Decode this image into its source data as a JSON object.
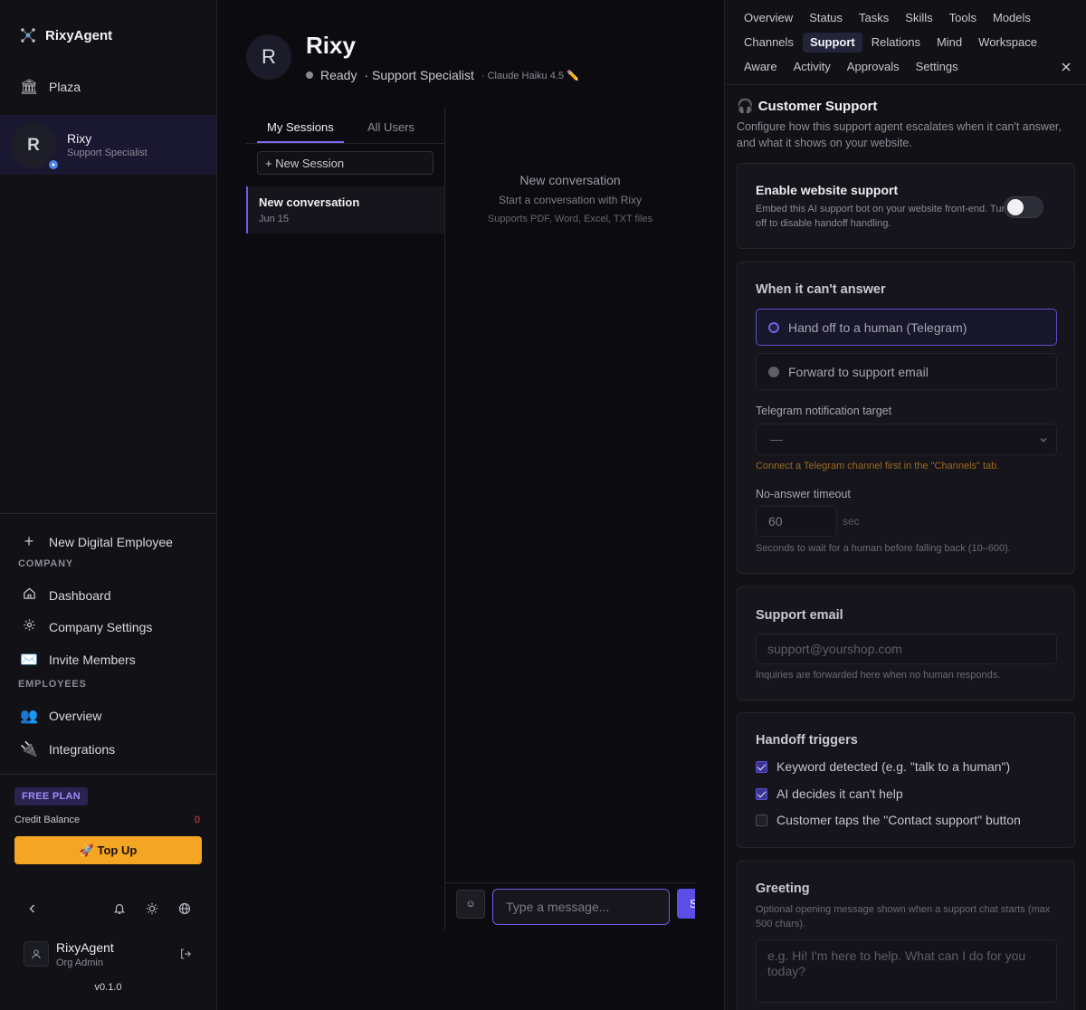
{
  "sidebar": {
    "brand": "RixyAgent",
    "plaza": "Plaza",
    "agent": {
      "initial": "R",
      "name": "Rixy",
      "role": "Support Specialist"
    },
    "new_employee": "New Digital Employee",
    "company_section": "COMPANY",
    "company_items": [
      "Dashboard",
      "Company Settings",
      "Invite Members"
    ],
    "employees_section": "EMPLOYEES",
    "employee_items": [
      "Overview",
      "Integrations"
    ],
    "plan": "FREE PLAN",
    "credit_label": "Credit Balance",
    "credit_value": "0",
    "topup": "🚀 Top Up",
    "user": {
      "name": "RixyAgent",
      "role": "Org Admin"
    },
    "version": "v0.1.0"
  },
  "main": {
    "avatar_initial": "R",
    "name": "Rixy",
    "status": "Ready",
    "role": "· Support Specialist",
    "model": "· Claude Haiku 4.5 ✏️",
    "tabs": [
      "My Sessions",
      "All Users"
    ],
    "new_session": "+ New Session",
    "session": {
      "title": "New conversation",
      "date": "Jun 15"
    },
    "empty_title": "New conversation",
    "empty_sub": "Start a conversation with Rixy",
    "empty_hint": "Supports PDF, Word, Excel, TXT files",
    "emoji": "☺",
    "input_placeholder": "Type a message...",
    "send": "Send"
  },
  "panel": {
    "tabs_row1": [
      "Overview",
      "Status",
      "Tasks",
      "Skills",
      "Tools",
      "Models"
    ],
    "tabs_row2": [
      "Channels",
      "Support",
      "Relations",
      "Mind",
      "Workspace"
    ],
    "tabs_row3": [
      "Aware",
      "Activity",
      "Approvals",
      "Settings"
    ],
    "active_tab": "Support",
    "title_icon": "🎧",
    "title": "Customer Support",
    "description": "Configure how this support agent escalates when it can't answer, and what it shows on your website.",
    "website": {
      "title": "Enable website support",
      "desc": "Embed this AI support bot on your website front-end. Turn off to disable handoff handling.",
      "enabled": false
    },
    "fallback": {
      "title": "When it can't answer",
      "options": [
        "Hand off to a human (Telegram)",
        "Forward to support email"
      ],
      "selected": 0,
      "telegram_label": "Telegram notification target",
      "telegram_value": "—",
      "telegram_warning": "Connect a Telegram channel first in the \"Channels\" tab.",
      "timeout_label": "No-answer timeout",
      "timeout_value": "60",
      "timeout_unit": "sec",
      "timeout_help": "Seconds to wait for a human before falling back (10–600)."
    },
    "email": {
      "title": "Support email",
      "placeholder": "support@yourshop.com",
      "help": "Inquiries are forwarded here when no human responds."
    },
    "triggers": {
      "title": "Handoff triggers",
      "items": [
        {
          "label": "Keyword detected (e.g. \"talk to a human\")",
          "checked": true
        },
        {
          "label": "AI decides it can't help",
          "checked": true
        },
        {
          "label": "Customer taps the \"Contact support\" button",
          "checked": false
        }
      ]
    },
    "greeting": {
      "title": "Greeting",
      "help": "Optional opening message shown when a support chat starts (max 500 chars).",
      "placeholder": "e.g. Hi! I'm here to help. What can I do for you today?"
    }
  }
}
